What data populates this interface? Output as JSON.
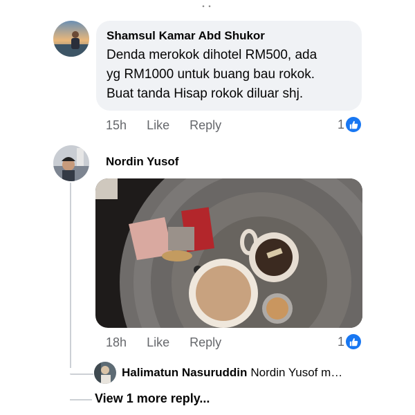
{
  "comments": [
    {
      "author": "Shamsul Kamar Abd Shukor",
      "text_lines": [
        "Denda merokok dihotel RM500, ada",
        "yg RM1000 untuk buang bau rokok.",
        "Buat tanda Hisap rokok diluar shj."
      ],
      "time": "15h",
      "like_label": "Like",
      "reply_label": "Reply",
      "reaction_count": "1",
      "reaction_icon": "like-thumb-icon"
    },
    {
      "author": "Nordin Yusof",
      "photo": "photo-attachment",
      "time": "18h",
      "like_label": "Like",
      "reply_label": "Reply",
      "reaction_count": "1",
      "reaction_icon": "like-thumb-icon",
      "reply_preview": {
        "author": "Halimatun Nasuruddin",
        "text": "Nordin Yusof m…"
      },
      "view_more": "View 1 more reply..."
    }
  ],
  "colors": {
    "bubble_bg": "#f0f2f5",
    "meta_text": "#65676b",
    "like_blue": "#1877f2",
    "thread_line": "#ccd0d5"
  }
}
